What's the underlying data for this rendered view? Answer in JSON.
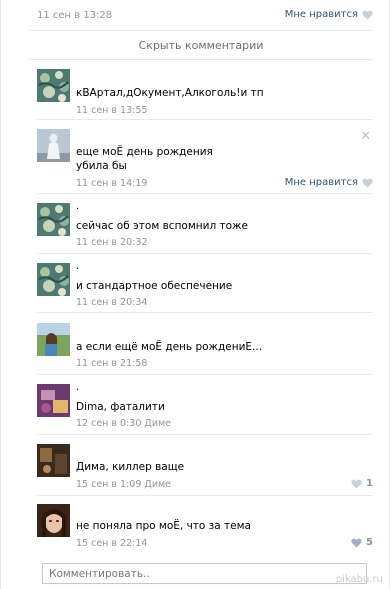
{
  "top": {
    "date": "11 сен в 13:28",
    "like_label": "Мне нравится"
  },
  "hide_comments": "Скрыть комментарии",
  "comments": [
    {
      "text": "кВАртал,дОкумент,Алкоголь!и тп",
      "dot": "",
      "date": "11 сен в 13:55",
      "reply_to": "",
      "like_label": "",
      "likes": "",
      "avatar": "vangogh-avatar"
    },
    {
      "text": "еще моЁ день рождения\nубила бы",
      "dot": "",
      "date": "11 сен в 14:19",
      "reply_to": "",
      "like_label": "Мне нравится",
      "likes": "",
      "avatar": "statue-avatar"
    },
    {
      "text": "сейчас об этом вспомнил тоже",
      "dot": ".",
      "date": "11 сен в 20:32",
      "reply_to": "",
      "like_label": "",
      "likes": "",
      "avatar": "vangogh-avatar"
    },
    {
      "text": "и стандартное обеспечение",
      "dot": ".",
      "date": "11 сен в 20:34",
      "reply_to": "",
      "like_label": "",
      "likes": "",
      "avatar": "vangogh-avatar"
    },
    {
      "text": "а если ещё моЁ день рождениЕ...",
      "dot": "",
      "date": "11 сен в 21:58",
      "reply_to": "",
      "like_label": "",
      "likes": "",
      "avatar": "girl-outdoor-avatar"
    },
    {
      "text": "Dima, фаталити",
      "dot": ".",
      "date": "12 сен в 0:30",
      "reply_to": "Диме",
      "like_label": "",
      "likes": "",
      "avatar": "purple-avatar"
    },
    {
      "text": "Дима, киллер ваще",
      "dot": "",
      "date": "15 сен в 1:09",
      "reply_to": "Диме",
      "like_label": "",
      "likes": "1",
      "avatar": "dark-room-avatar"
    },
    {
      "text": "не поняла про моЁ, что за тема",
      "dot": "",
      "date": "15 сен в 22:14",
      "reply_to": "",
      "like_label": "",
      "likes": "5",
      "avatar": "girl-face-avatar"
    }
  ],
  "input": {
    "placeholder": "Комментировать.."
  },
  "watermark": "pikabu.ru"
}
